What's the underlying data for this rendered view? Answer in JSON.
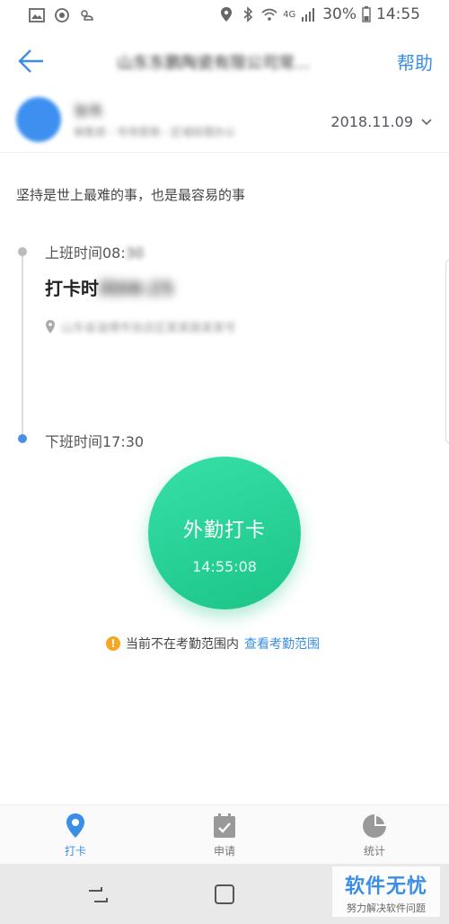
{
  "status_bar": {
    "battery": "30%",
    "time": "14:55",
    "network": "4G"
  },
  "nav": {
    "title": "山东东鹏陶瓷有限公司常...",
    "help": "帮助"
  },
  "user": {
    "name": "张伟",
    "dept": "销售部 - 市场营销 - 区域经理办公",
    "date": "2018.11.09"
  },
  "motto": "坚持是世上最难的事，也是最容易的事",
  "timeline": {
    "on_label": "上班时间08:",
    "on_label_tail": "30",
    "punch_title": "打卡时",
    "punch_title_tail": "间08:25",
    "location": "山东省淄博市张店区某某路某某号",
    "off_label": "下班时间17:30"
  },
  "punch_button": {
    "label": "外勤打卡",
    "time": "14:55:08"
  },
  "warning": {
    "text": "当前不在考勤范围内",
    "link": "查看考勤范围"
  },
  "tabs": {
    "punch": "打卡",
    "apply": "申请",
    "stats": "统计"
  },
  "watermark": {
    "main": "软件无忧",
    "sub": "努力解决软件问题"
  },
  "colors": {
    "accent": "#3a8ee6",
    "punch_green": "#1cc487",
    "warning": "#f5a623"
  }
}
